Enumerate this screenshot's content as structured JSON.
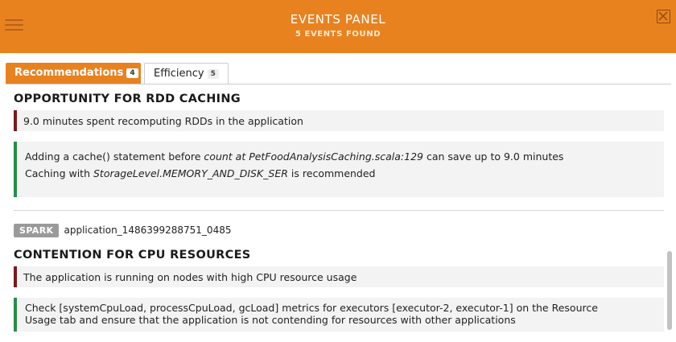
{
  "header": {
    "title": "EVENTS PANEL",
    "subtitle": "5 EVENTS FOUND",
    "accent_color": "#e8821f",
    "menu_icon": "hamburger-icon",
    "close_icon": "close-icon"
  },
  "tabs": [
    {
      "label": "Recommendations",
      "count": "4",
      "active": true
    },
    {
      "label": "Efficiency",
      "count": "5",
      "active": false
    }
  ],
  "events": [
    {
      "title": "OPPORTUNITY FOR RDD CACHING",
      "symptom": "9.0 minutes spent recomputing RDDs in the application",
      "advice_line1_pre": "Adding a cache() statement before ",
      "advice_line1_em": "count at PetFoodAnalysisCaching.scala:129",
      "advice_line1_post": " can save up to 9.0 minutes",
      "advice_line2_pre": "Caching with ",
      "advice_line2_em": "StorageLevel.MEMORY_AND_DISK_SER",
      "advice_line2_post": " is recommended"
    },
    {
      "badge": "SPARK",
      "app_id": "application_1486399288751_0485",
      "title": "CONTENTION FOR CPU RESOURCES",
      "symptom": "The application is running on nodes with high CPU resource usage",
      "advice_line1": "Check [systemCpuLoad, processCpuLoad, gcLoad] metrics for executors [executor-2, executor-1] on the Resource",
      "advice_line2": "Usage tab and ensure that the application is not contending for resources with other applications"
    }
  ],
  "colors": {
    "symptom_border": "#7a1a1a",
    "advice_border": "#2a8c4a",
    "badge_bg": "#9a9a9a"
  }
}
